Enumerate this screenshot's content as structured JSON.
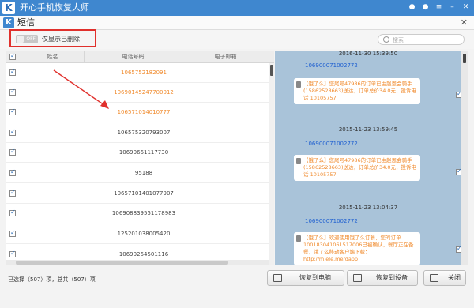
{
  "app": {
    "title": "开心手机恢复大师",
    "logo": "K"
  },
  "subheader": {
    "title": "短信",
    "logo": "K"
  },
  "filter": {
    "toggle_state": "OFF",
    "label": "仅显示已删除"
  },
  "search": {
    "placeholder": "搜索"
  },
  "list": {
    "columns": [
      "姓名",
      "电话号码",
      "电子邮箱"
    ],
    "rows": [
      {
        "phone": "1065752182091",
        "deleted": true
      },
      {
        "phone": "10690145247700012",
        "deleted": true
      },
      {
        "phone": "106571014010777",
        "deleted": true
      },
      {
        "phone": "106575320793007",
        "deleted": false
      },
      {
        "phone": "10690661117730",
        "deleted": false
      },
      {
        "phone": "95188",
        "deleted": false
      },
      {
        "phone": "10657101401077907",
        "deleted": false
      },
      {
        "phone": "106908839551178983",
        "deleted": false
      },
      {
        "phone": "125201038005420",
        "deleted": false
      },
      {
        "phone": "10690264501116",
        "deleted": false
      }
    ]
  },
  "messages": [
    {
      "date": "2016-11-30 15:39:50",
      "sender": "1069000710027​72",
      "text": "【饿了么】您尾号47986的订单已由赵恩会骑手(15862528663)送达，订单总价34.0元，投诉电话 10105757"
    },
    {
      "date": "2015-11-23 13:59:45",
      "sender": "106900071002772",
      "text": "【饿了么】您尾号47986的订单已由赵恩会骑手(15862528663)送达，订单总价34.0元，投诉电话 10105757"
    },
    {
      "date": "2015-11-23 13:04:37",
      "sender": "106900071002772",
      "text": "【饿了么】欢迎使用饿了么订餐，您的订单100183041061517006已被确认，餐厅正在备餐，饿了么移动客户端下载：http://m.ele.me/dapp"
    }
  ],
  "footer": {
    "status": "已选择（507）项，总共（507）项",
    "buttons": {
      "restore_pc": "恢复到电脑",
      "restore_device": "恢复到设备",
      "close": "关闭"
    }
  },
  "colors": {
    "accent": "#3f87cf",
    "deleted_text": "#f08a2c",
    "highlight_box": "#e0302c",
    "message_bg": "#a9c3d9"
  }
}
